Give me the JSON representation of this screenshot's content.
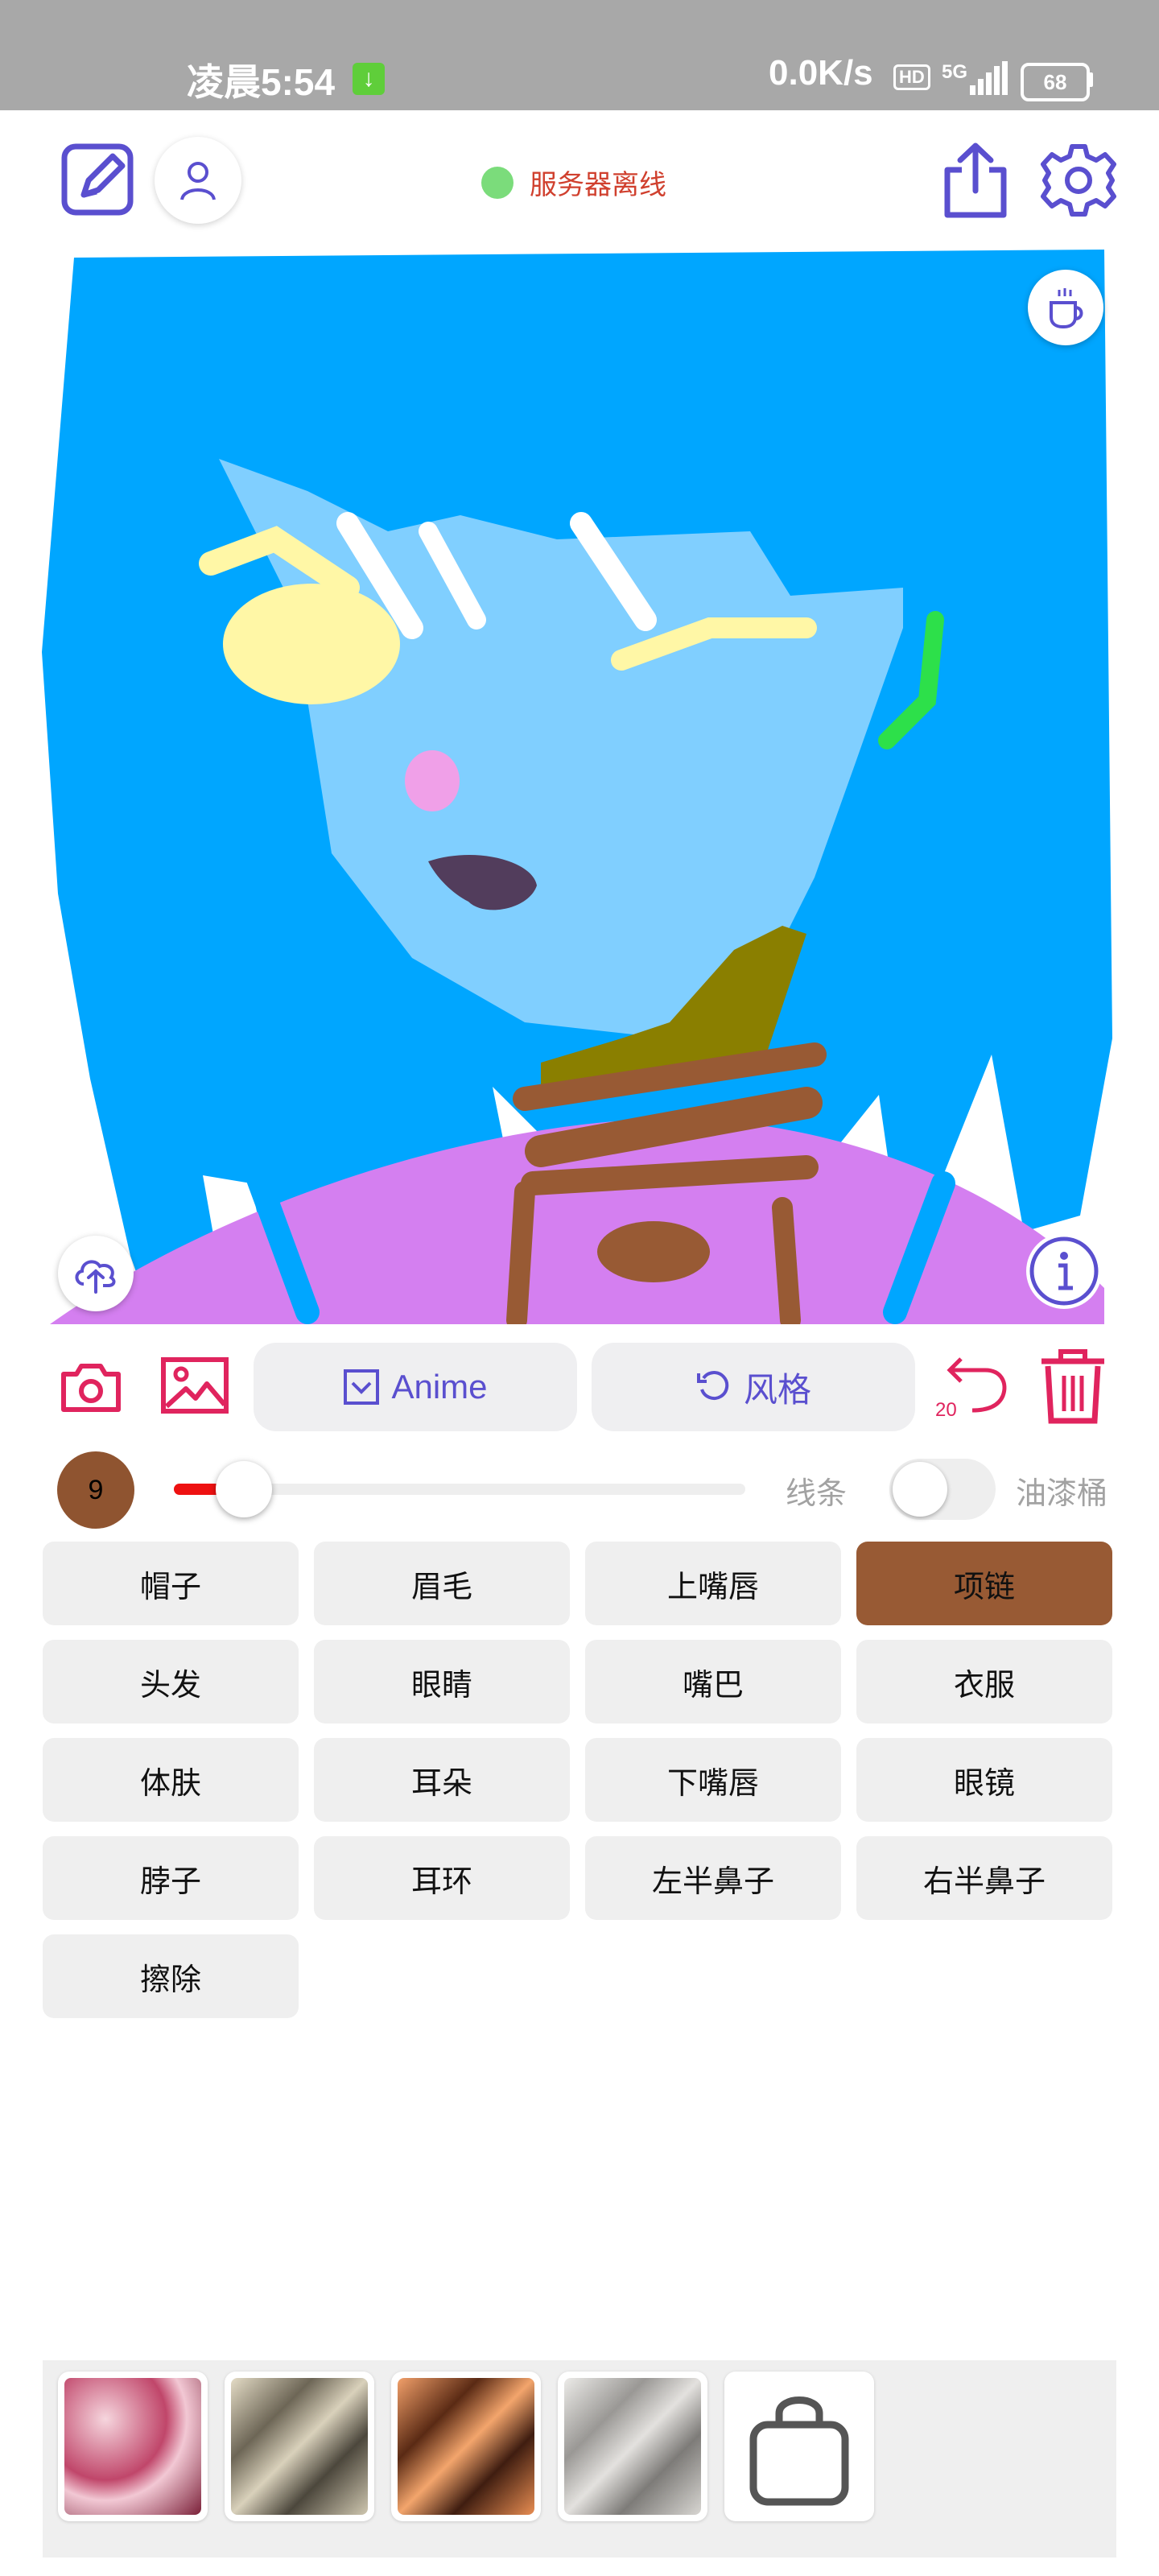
{
  "status_bar": {
    "time": "凌晨5:54",
    "download_icon": "download-arrow-icon",
    "network_speed": "0.0K/s",
    "hd_badge": "HD",
    "signal_label": "5G",
    "battery": "68"
  },
  "header": {
    "edit_icon": "pencil-square-icon",
    "profile_icon": "user-icon",
    "server_status": "服务器离线",
    "server_status_color": "#7bdc7b",
    "share_icon": "share-icon",
    "settings_icon": "gear-icon"
  },
  "canvas": {
    "coffee_icon": "coffee-cup-icon",
    "upload_icon": "cloud-upload-icon",
    "info_icon": "info-icon"
  },
  "toolbar": {
    "camera_icon": "camera-icon",
    "gallery_icon": "image-icon",
    "model_label": "Anime",
    "style_label": "风格",
    "undo_count": "20",
    "delete_icon": "trash-icon"
  },
  "brush": {
    "size": "9",
    "size_color": "#8f5430",
    "slider_value_percent": 10,
    "line_label": "线条",
    "bucket_label": "油漆桶",
    "bucket_enabled": false
  },
  "parts": [
    {
      "label": "帽子",
      "active": false
    },
    {
      "label": "眉毛",
      "active": false
    },
    {
      "label": "上嘴唇",
      "active": false
    },
    {
      "label": "项链",
      "active": true
    },
    {
      "label": "头发",
      "active": false
    },
    {
      "label": "眼睛",
      "active": false
    },
    {
      "label": "嘴巴",
      "active": false
    },
    {
      "label": "衣服",
      "active": false
    },
    {
      "label": "体肤",
      "active": false
    },
    {
      "label": "耳朵",
      "active": false
    },
    {
      "label": "下嘴唇",
      "active": false
    },
    {
      "label": "眼镜",
      "active": false
    },
    {
      "label": "脖子",
      "active": false
    },
    {
      "label": "耳环",
      "active": false
    },
    {
      "label": "左半鼻子",
      "active": false
    },
    {
      "label": "右半鼻子",
      "active": false
    },
    {
      "label": "擦除",
      "active": false
    }
  ],
  "styles": {
    "thumbnails": [
      "style-thumb-1",
      "style-thumb-2",
      "style-thumb-3",
      "style-thumb-4"
    ],
    "shop_icon": "shopping-bag-icon"
  },
  "colors": {
    "accent_purple": "#5a4fcf",
    "accent_red": "#e0245e",
    "active_part": "#985a34",
    "slider_fill": "#ee1111"
  }
}
